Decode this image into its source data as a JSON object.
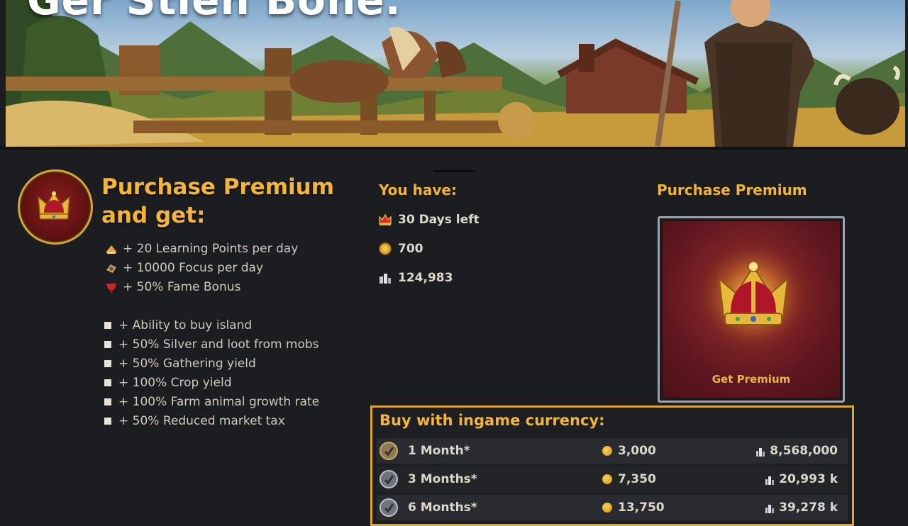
{
  "banner": {
    "title": "Ger Stien Bone."
  },
  "promo": {
    "title_line1": "Purchase Premium",
    "title_line2": "and get:",
    "perks": [
      {
        "icon": "learning-points-icon",
        "label": "+ 20 Learning Points per day"
      },
      {
        "icon": "focus-icon",
        "label": "+ 10000 Focus per day"
      },
      {
        "icon": "fame-icon",
        "label": "+ 50% Fame Bonus"
      }
    ],
    "benefits": [
      "+ Ability to buy island",
      "+ 50% Silver and loot from mobs",
      "+ 50% Gathering yield",
      "+ 100% Crop yield",
      "+ 100% Farm animal growth rate",
      "+ 50% Reduced market tax"
    ]
  },
  "you_have": {
    "heading": "You have:",
    "premium_days": "30 Days left",
    "gold": "700",
    "silver": "124,983"
  },
  "premium_card": {
    "heading": "Purchase Premium",
    "button_label": "Get Premium"
  },
  "buy": {
    "title": "Buy with ingame currency:",
    "rows": [
      {
        "label": "1 Month*",
        "gold": "3,000",
        "silver": "8,568,000"
      },
      {
        "label": "3 Months*",
        "gold": "7,350",
        "silver": "20,993 k"
      },
      {
        "label": "6 Months*",
        "gold": "13,750",
        "silver": "39,278 k"
      }
    ]
  },
  "colors": {
    "accent": "#f2b43c",
    "background": "#1c1d21",
    "premium_red": "#7c2324",
    "card_border": "#9aa3ad",
    "panel_border": "#e0a53a"
  }
}
